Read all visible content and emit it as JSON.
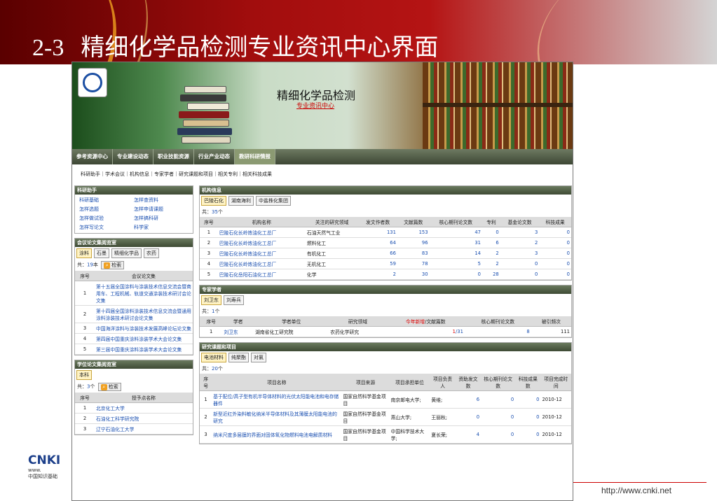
{
  "slide": {
    "number": "2-3",
    "title": "精细化学品检测专业资讯中心界面",
    "url": "http://www.cnki.net",
    "cnki_logo": "CNKI",
    "cnki_sub_logo": "www.",
    "cnki_footer": "中国知识基础"
  },
  "banner": {
    "title": "精细化学品检测",
    "subtitle": "专业资讯中心"
  },
  "nav": [
    "参考资源中心",
    "专业建设动态",
    "职业技能资源",
    "行业产业动态",
    "教研科研情报"
  ],
  "subnav": "科研助手｜学术会议｜机构信息｜专家学者｜研究课题和项目｜相关专利｜相关科技成果",
  "keyan": {
    "header": "科研助手",
    "items": [
      "科研基础",
      "怎样查资料",
      "怎样选题",
      "怎样申请课题",
      "怎样做试验",
      "怎样搞科研",
      "怎样写论文",
      "科学家"
    ]
  },
  "conf": {
    "header": "会议论文集阅览室",
    "tabs": [
      "涂料",
      "石墨",
      "精细化学品",
      "农药"
    ],
    "count_prefix": "共：",
    "count": "19",
    "count_suffix": "本",
    "search": "检索",
    "cols": [
      "序号",
      "会议论文集"
    ],
    "rows": [
      {
        "no": "1",
        "name": "第十五届全国涂料与涂装技术信息交流会暨商用车、工程机械、轨道交通涂装技术研讨会论文集"
      },
      {
        "no": "2",
        "name": "第十四届全国涂料涂装技术信息交流会暨通用涂料涂装技术研讨会论文集"
      },
      {
        "no": "3",
        "name": "中国海洋涂料与涂装技术发展高峰论坛论文集"
      },
      {
        "no": "4",
        "name": "第四届中国重庆涂料涂装学术大会论文集"
      },
      {
        "no": "5",
        "name": "第三届中国重庆涂料涂装学术大会论文集"
      }
    ]
  },
  "thesis": {
    "header": "学位论文集阅览室",
    "tabs": [
      "本科"
    ],
    "count_prefix": "共：",
    "count": "3",
    "count_suffix": "个",
    "search": "检索",
    "cols": [
      "序号",
      "授予点名称"
    ],
    "rows": [
      {
        "no": "1",
        "name": "北京化工大学"
      },
      {
        "no": "2",
        "name": "石油化工科学研究院"
      },
      {
        "no": "3",
        "name": "辽宁石油化工大学"
      }
    ]
  },
  "org": {
    "header": "机构信息",
    "tabs": [
      "巴陵石化",
      "湖南海利",
      "中盐株化集团"
    ],
    "count_prefix": "共：",
    "count": "35",
    "count_suffix": "个",
    "cols": [
      "序号",
      "机构名称",
      "关注的研究领域",
      "发文作者数",
      "文献篇数",
      "核心期刊论文数",
      "专利",
      "基金论文数",
      "科技成果"
    ],
    "rows": [
      [
        "1",
        "巴陵石化长岭炼油化工总厂",
        "石油天然气工业",
        "131",
        "153",
        "47",
        "0",
        "3",
        "0"
      ],
      [
        "2",
        "巴陵石化长岭炼油化工总厂",
        "燃料化工",
        "64",
        "96",
        "31",
        "6",
        "2",
        "0"
      ],
      [
        "3",
        "巴陵石化长岭炼油化工总厂",
        "有机化工",
        "66",
        "83",
        "14",
        "2",
        "3",
        "0"
      ],
      [
        "4",
        "巴陵石化长岭炼油化工总厂",
        "无机化工",
        "59",
        "78",
        "5",
        "2",
        "0",
        "0"
      ],
      [
        "5",
        "巴陵石化岳阳石油化工总厂",
        "化学",
        "2",
        "30",
        "0",
        "28",
        "0",
        "0"
      ]
    ]
  },
  "expert": {
    "header": "专家学者",
    "tabs": [
      "刘卫东",
      "刘寿兵"
    ],
    "count_prefix": "共：",
    "count": "1",
    "count_suffix": "个",
    "cols": [
      "序号",
      "学者",
      "学者单位",
      "研究领域",
      "今年新增",
      "/文献篇数",
      "核心期刊论文数",
      "被引频次"
    ],
    "rows": [
      [
        "1",
        "刘卫东",
        "湖南省化工研究院",
        "农药化学研究",
        "1",
        "/31",
        "8",
        "111"
      ]
    ]
  },
  "project": {
    "header": "研究课题和项目",
    "tabs": [
      "电池材料",
      "纯聚酯",
      "对氯"
    ],
    "count_prefix": "共：",
    "count": "20",
    "count_suffix": "个",
    "cols": [
      "序号",
      "项目名称",
      "项目来源",
      "项目承担单位",
      "项目负责人",
      "资助发文数",
      "核心期刊论文数",
      "科技成果数",
      "项目完成时间"
    ],
    "rows": [
      [
        "1",
        "基于配位/高子型有机半导体材料的光伏太阳能电池和电存储器件",
        "国家自然科学基金项目",
        "南京邮电大学;",
        "黄维;",
        "6",
        "0",
        "0",
        "2010-12"
      ],
      [
        "2",
        "新型近红外染料敏化纳米半导体材料及其薄膜太阳能电池的研究",
        "国家自然科学基金项目",
        "燕山大学;",
        "王丽秋;",
        "0",
        "0",
        "0",
        "2010-12"
      ],
      [
        "3",
        "纳米尺度多层膜的界面对固体氧化物燃料电池电解质材料",
        "国家自然科学基金项目",
        "中国科学技术大学;",
        "夏长荣;",
        "4",
        "0",
        "0",
        "2010-12"
      ]
    ]
  }
}
